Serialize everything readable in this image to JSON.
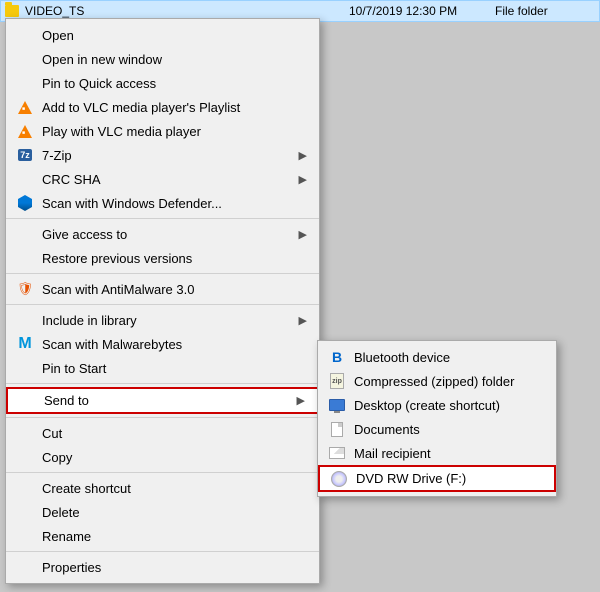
{
  "fileRow": {
    "name": "VIDEO_TS",
    "date": "10/7/2019 12:30 PM",
    "type": "File folder"
  },
  "contextMenu": {
    "items": [
      {
        "id": "open",
        "label": "Open",
        "icon": null,
        "hasArrow": false,
        "separator_before": false
      },
      {
        "id": "open-new-window",
        "label": "Open in new window",
        "icon": null,
        "hasArrow": false,
        "separator_before": false
      },
      {
        "id": "pin-quick-access",
        "label": "Pin to Quick access",
        "icon": null,
        "hasArrow": false,
        "separator_before": false
      },
      {
        "id": "add-vlc-playlist",
        "label": "Add to VLC media player's Playlist",
        "icon": "vlc",
        "hasArrow": false,
        "separator_before": false
      },
      {
        "id": "play-vlc",
        "label": "Play with VLC media player",
        "icon": "vlc",
        "hasArrow": false,
        "separator_before": false
      },
      {
        "id": "7zip",
        "label": "7-Zip",
        "icon": "7zip",
        "hasArrow": true,
        "separator_before": false
      },
      {
        "id": "crc-sha",
        "label": "CRC SHA",
        "icon": null,
        "hasArrow": true,
        "separator_before": false
      },
      {
        "id": "scan-defender",
        "label": "Scan with Windows Defender...",
        "icon": "defender",
        "hasArrow": false,
        "separator_before": false
      },
      {
        "id": "separator1",
        "label": "",
        "icon": null,
        "hasArrow": false,
        "separator_before": false,
        "isSeparator": true
      },
      {
        "id": "give-access",
        "label": "Give access to",
        "icon": null,
        "hasArrow": true,
        "separator_before": false
      },
      {
        "id": "restore-versions",
        "label": "Restore previous versions",
        "icon": null,
        "hasArrow": false,
        "separator_before": false
      },
      {
        "id": "separator2",
        "label": "",
        "icon": null,
        "hasArrow": false,
        "separator_before": false,
        "isSeparator": true
      },
      {
        "id": "scan-antimalware",
        "label": "Scan with AntiMalware 3.0",
        "icon": "antimalware",
        "hasArrow": false,
        "separator_before": false
      },
      {
        "id": "separator3",
        "label": "",
        "icon": null,
        "hasArrow": false,
        "separator_before": false,
        "isSeparator": true
      },
      {
        "id": "include-library",
        "label": "Include in library",
        "icon": null,
        "hasArrow": true,
        "separator_before": false
      },
      {
        "id": "scan-malwarebytes",
        "label": "Scan with Malwarebytes",
        "icon": "malwarebytes",
        "hasArrow": false,
        "separator_before": false
      },
      {
        "id": "pin-start",
        "label": "Pin to Start",
        "icon": null,
        "hasArrow": false,
        "separator_before": false
      },
      {
        "id": "separator4",
        "label": "",
        "icon": null,
        "hasArrow": false,
        "separator_before": false,
        "isSeparator": true
      },
      {
        "id": "send-to",
        "label": "Send to",
        "icon": null,
        "hasArrow": true,
        "separator_before": false,
        "highlighted": true
      },
      {
        "id": "separator5",
        "label": "",
        "icon": null,
        "hasArrow": false,
        "separator_before": false,
        "isSeparator": true
      },
      {
        "id": "cut",
        "label": "Cut",
        "icon": null,
        "hasArrow": false,
        "separator_before": false
      },
      {
        "id": "copy",
        "label": "Copy",
        "icon": null,
        "hasArrow": false,
        "separator_before": false
      },
      {
        "id": "separator6",
        "label": "",
        "icon": null,
        "hasArrow": false,
        "separator_before": false,
        "isSeparator": true
      },
      {
        "id": "create-shortcut",
        "label": "Create shortcut",
        "icon": null,
        "hasArrow": false,
        "separator_before": false
      },
      {
        "id": "delete",
        "label": "Delete",
        "icon": null,
        "hasArrow": false,
        "separator_before": false
      },
      {
        "id": "rename",
        "label": "Rename",
        "icon": null,
        "hasArrow": false,
        "separator_before": false
      },
      {
        "id": "separator7",
        "label": "",
        "icon": null,
        "hasArrow": false,
        "separator_before": false,
        "isSeparator": true
      },
      {
        "id": "properties",
        "label": "Properties",
        "icon": null,
        "hasArrow": false,
        "separator_before": false
      }
    ]
  },
  "submenu": {
    "items": [
      {
        "id": "bluetooth",
        "label": "Bluetooth device",
        "icon": "bluetooth",
        "highlighted": false
      },
      {
        "id": "compressed",
        "label": "Compressed (zipped) folder",
        "icon": "zip",
        "highlighted": false
      },
      {
        "id": "desktop",
        "label": "Desktop (create shortcut)",
        "icon": "desktop",
        "highlighted": false
      },
      {
        "id": "documents",
        "label": "Documents",
        "icon": "documents",
        "highlighted": false
      },
      {
        "id": "mail-recipient",
        "label": "Mail recipient",
        "icon": "mail",
        "highlighted": false
      },
      {
        "id": "dvd-rw",
        "label": "DVD RW Drive (F:)",
        "icon": "dvd",
        "highlighted": true
      }
    ]
  }
}
